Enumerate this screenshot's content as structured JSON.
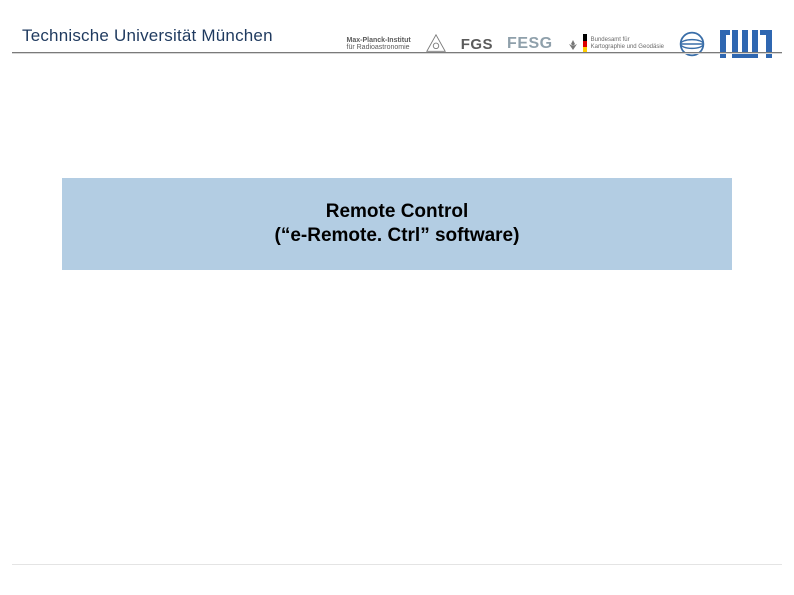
{
  "header": {
    "university": "Technische Universität München",
    "logos": {
      "mpi_line1": "Max-Planck-Institut",
      "mpi_line2": "für Radioastronomie",
      "fgs": "FGS",
      "fesg": "FESG",
      "bund_line1": "Bundesamt für",
      "bund_line2": "Kartographie und Geodäsie"
    }
  },
  "title": {
    "line1": "Remote Control",
    "line2": "(“e-Remote. Ctrl” software)"
  },
  "colors": {
    "title_bg": "#b3cde3",
    "header_text": "#1f3a5f",
    "tum_blue": "#2f67b1"
  }
}
